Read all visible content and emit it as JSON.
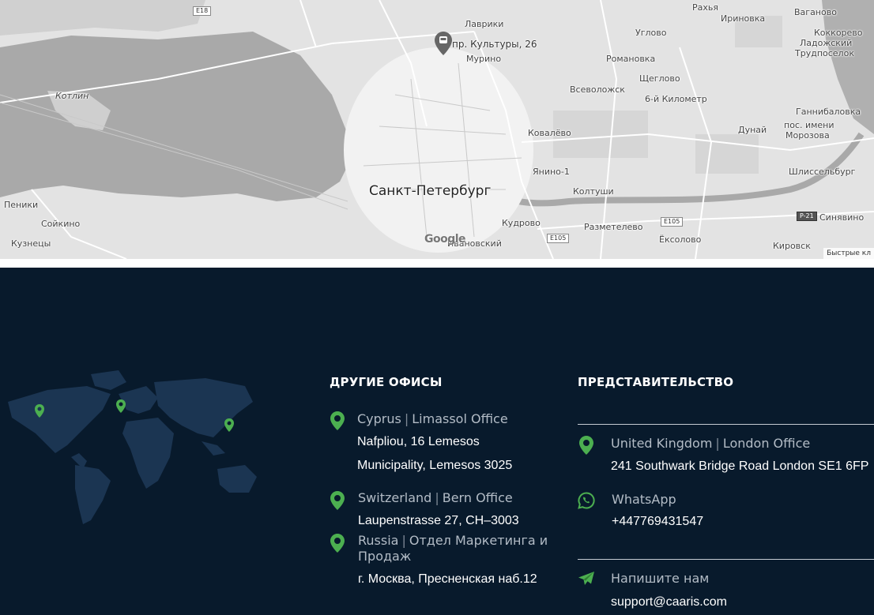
{
  "map": {
    "labels": {
      "e18": "E18",
      "lavriki": "Лаврики",
      "pin_label": "пр. Культуры, 26",
      "murino": "Мурино",
      "rakhya": "Рахья",
      "irinovka": "Ириновка",
      "vaganovo": "Ваганово",
      "koltushi_north": "Углово",
      "kokkorevo": "Коккорево",
      "ladozhsky": "Ладожский",
      "trudposelok": "Трудпоселок",
      "romanovka": "Романовка",
      "shcheglovo": "Щеглово",
      "vsevolozhsk": "Всеволожск",
      "km6": "6-й Километр",
      "kotlin": "Котлин",
      "gannibalovka": "Ганнибаловка",
      "pos_imeni": "пос. имени",
      "morozova": "Морозова",
      "dunai": "Дунай",
      "kovalevo": "Ковалёво",
      "yanino": "Янино-1",
      "shlisselburg": "Шлиссельбург",
      "spb": "Санкт-Петербург",
      "koltushi": "Колтуши",
      "peniki": "Пеники",
      "e105_a": "E105",
      "p21": "P-21",
      "sinyavino": "Синявино",
      "soikino": "Сойкино",
      "kudrovo": "Кудрово",
      "razmetelevo": "Разметелево",
      "e105_b": "E105",
      "eksolovo": "Ёксолово",
      "kuznetsy": "Кузнецы",
      "ivanovsky": "Ивановский",
      "kirovsk": "Кировск",
      "google": "Google",
      "shortcuts": "Быстрые кл"
    }
  },
  "other_offices": {
    "title": "ДРУГИЕ ОФИСЫ",
    "cyprus": {
      "country": "Cyprus",
      "office": "Limassol Office",
      "line1": "Nafpliou, 16 Lemesos",
      "line2": "Municipality, Lemesos 3025"
    },
    "switzerland": {
      "country": "Switzerland",
      "office": "Bern Office",
      "line1": "Laupenstrasse 27, CH–3003"
    },
    "russia": {
      "country": "Russia",
      "office": "Отдел Маркетинга и",
      "office2": "Продаж",
      "line1": "г. Москва, Пресненская наб.12"
    }
  },
  "representation": {
    "title": "ПРЕДСТАВИТЕЛЬСТВО",
    "uk": {
      "country": "United Kingdom",
      "office": "London Office",
      "line1": "241 Southwark Bridge Road London SE1 6FP"
    },
    "whatsapp": {
      "label": "WhatsApp",
      "phone": "+447769431547"
    },
    "email": {
      "label": "Напишите нам",
      "address": "support@caaris.com"
    }
  },
  "colors": {
    "footer_bg": "#081a2c",
    "accent_green": "#4caf50",
    "world_map": "#1b3552"
  }
}
